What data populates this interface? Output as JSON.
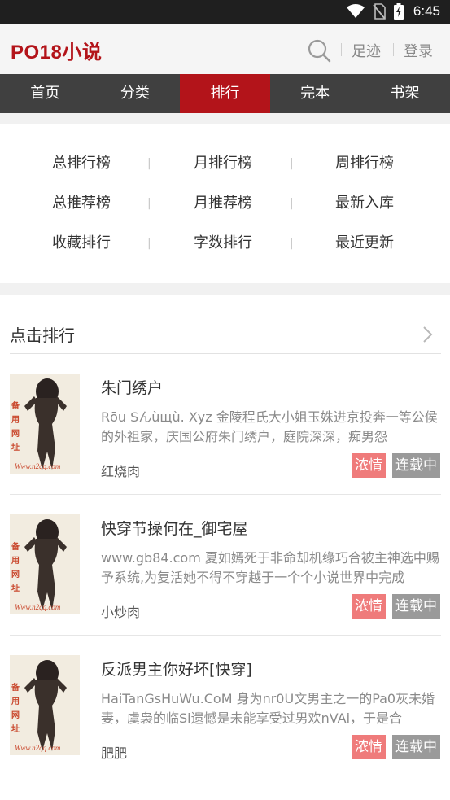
{
  "status_bar": {
    "time": "6:45",
    "icons": [
      "wifi-icon",
      "no-sim-icon",
      "battery-charging-icon"
    ]
  },
  "header": {
    "logo": "PO18小说",
    "search_icon": "search-icon",
    "links": [
      "足迹",
      "登录"
    ]
  },
  "nav": {
    "tabs": [
      {
        "label": "首页"
      },
      {
        "label": "分类"
      },
      {
        "label": "排行",
        "active": true
      },
      {
        "label": "完本"
      },
      {
        "label": "书架"
      }
    ]
  },
  "rank_menu": {
    "rows": [
      [
        "总排行榜",
        "月排行榜",
        "周排行榜"
      ],
      [
        "总推荐榜",
        "月推荐榜",
        "最新入库"
      ],
      [
        "收藏排行",
        "字数排行",
        "最近更新"
      ]
    ],
    "separator": "|"
  },
  "section": {
    "title": "点击排行",
    "arrow_icon": "chevron-right-icon"
  },
  "cover": {
    "lettering": [
      "备",
      "用",
      "网",
      "址"
    ],
    "url": "Www.n2qq.com"
  },
  "books": [
    {
      "title": "朱门绣户",
      "description": "Rōu Sんùщù. Xyz 金陵程氏大小姐玉姝进京投奔一等公侯的外祖家，庆国公府朱门绣户，庭院深深，痴男怨",
      "author": "红烧肉",
      "genre": "浓情",
      "status": "连载中"
    },
    {
      "title": "快穿节操何在_御宅屋",
      "description": "www.gb84.com 夏如嫣死于非命却机缘巧合被主神选中赐予系统,为复活她不得不穿越于一个个小说世界中完成",
      "author": "小炒肉",
      "genre": "浓情",
      "status": "连载中"
    },
    {
      "title": "反派男主你好坏[快穿]",
      "description": "HaiTanGsHuWu.CoM 身为nr0U文男主之一的Pa0灰未婚妻，虞袅的临Si遗憾是未能享受过男欢nVAi，于是合",
      "author": "肥肥",
      "genre": "浓情",
      "status": "连载中"
    }
  ],
  "colors": {
    "brand_red": "#b3141a",
    "nav_bg": "#404040",
    "tag_genre": "#ef7b7b",
    "tag_status": "#9a9a9a"
  }
}
